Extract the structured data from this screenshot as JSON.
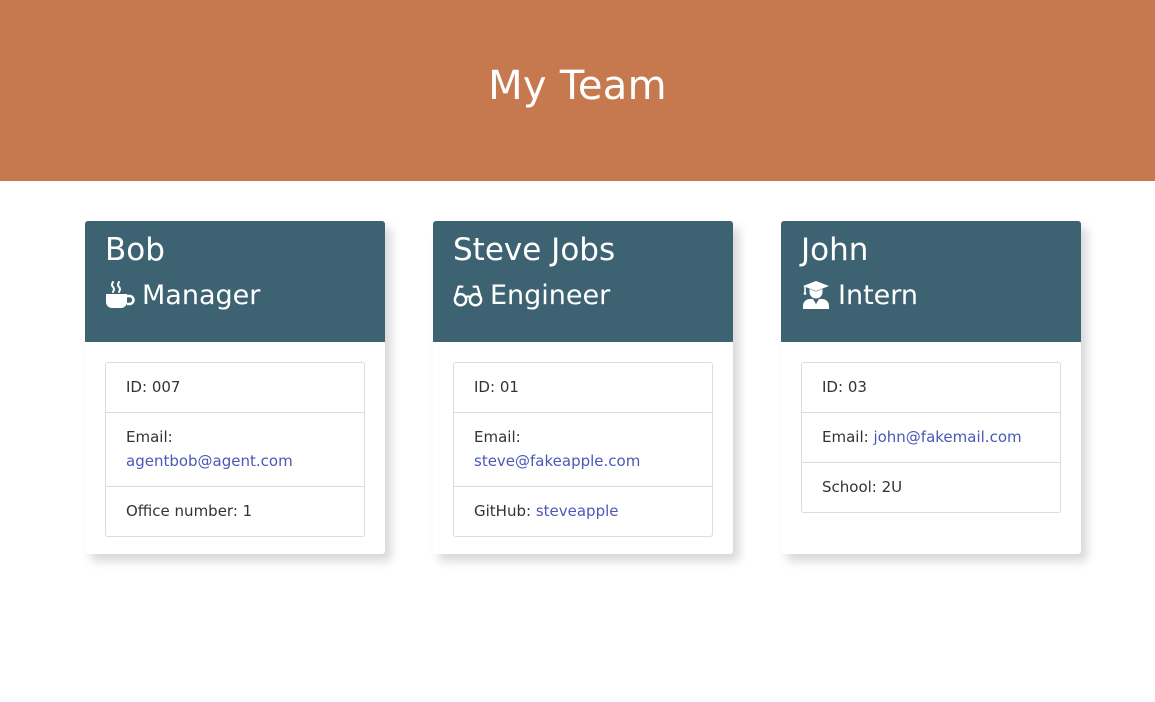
{
  "header": {
    "title": "My Team"
  },
  "cards": [
    {
      "name": "Bob",
      "role": "Manager",
      "role_icon": "coffee-mug-icon",
      "id_label": "ID:",
      "id_value": "007",
      "email_label": "Email:",
      "email": "agentbob@agent.com",
      "extra_label": "Office number:",
      "extra_value": "1"
    },
    {
      "name": "Steve Jobs",
      "role": "Engineer",
      "role_icon": "glasses-icon",
      "id_label": "ID:",
      "id_value": "01",
      "email_label": "Email:",
      "email": "steve@fakeapple.com",
      "extra_label": "GitHub:",
      "extra_value": "steveapple"
    },
    {
      "name": "John",
      "role": "Intern",
      "role_icon": "graduate-icon",
      "id_label": "ID:",
      "id_value": "03",
      "email_label": "Email:",
      "email": "john@fakemail.com",
      "extra_label": "School:",
      "extra_value": "2U"
    }
  ],
  "colors": {
    "banner": "#c6794f",
    "card_header": "#3d6373",
    "link": "#4a58b8"
  }
}
